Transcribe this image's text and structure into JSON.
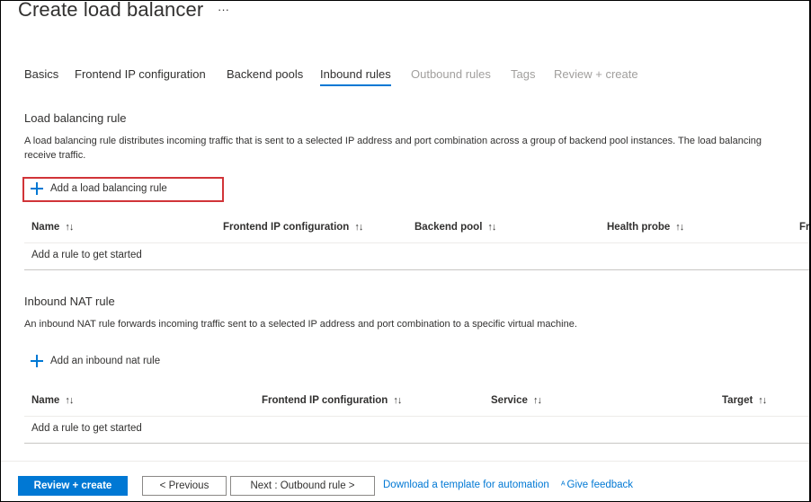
{
  "header": {
    "title": "Create load balancer",
    "more_label": "···"
  },
  "tabs": [
    {
      "label": "Basics",
      "state": "enabled"
    },
    {
      "label": "Frontend IP configuration",
      "state": "enabled"
    },
    {
      "label": "Backend pools",
      "state": "enabled"
    },
    {
      "label": "Inbound rules",
      "state": "active"
    },
    {
      "label": "Outbound rules",
      "state": "disabled"
    },
    {
      "label": "Tags",
      "state": "disabled"
    },
    {
      "label": "Review + create",
      "state": "disabled"
    }
  ],
  "lb_rule": {
    "title": "Load balancing rule",
    "description_line1": "A load balancing rule distributes incoming traffic that is sent to a selected IP address and port combination across a group of backend pool instances. The load balancing",
    "description_line2": "receive traffic.",
    "add_label": "Add a load balancing rule",
    "columns": [
      "Name",
      "Frontend IP configuration",
      "Backend pool",
      "Health probe",
      "Fro"
    ],
    "empty_text": "Add a rule to get started"
  },
  "nat_rule": {
    "title": "Inbound NAT rule",
    "description": "An inbound NAT rule forwards incoming traffic sent to a selected IP address and port combination to a specific virtual machine.",
    "add_label": "Add an inbound nat rule",
    "columns": [
      "Name",
      "Frontend IP configuration",
      "Service",
      "Target"
    ],
    "empty_text": "Add a rule to get started"
  },
  "sort_icon": "↑↓",
  "footer": {
    "review_create": "Review + create",
    "previous": "< Previous",
    "next": "Next : Outbound rule >",
    "download_template": "Download a template for automation",
    "feedback_icon": "ᴬ",
    "give_feedback": "Give feedback"
  },
  "colors": {
    "accent": "#0078d4",
    "highlight_border": "#d13438",
    "disabled_text": "#a19f9d"
  }
}
